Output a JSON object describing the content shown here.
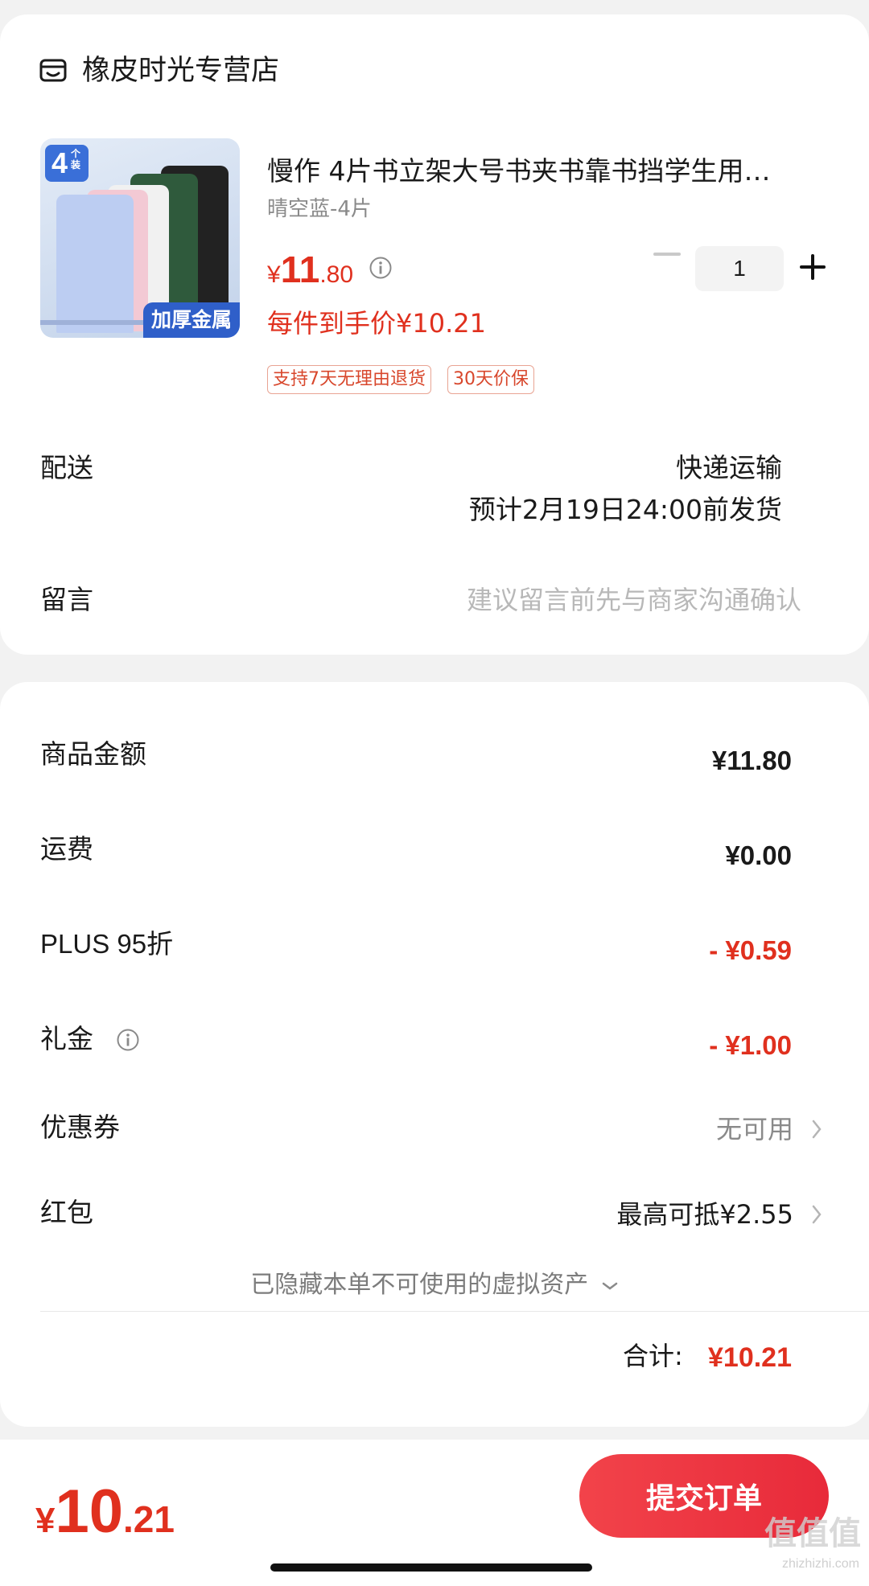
{
  "store": {
    "name": "橡皮时光专营店",
    "icon": "store-icon"
  },
  "product": {
    "title": "慢作 4片书立架大号书夹书靠书挡学生用…",
    "variant": "晴空蓝-4片",
    "price_currency": "¥",
    "price_int": "11",
    "price_dec": ".80",
    "final_price_text": "每件到手价¥10.21",
    "badges": [
      "支持7天无理由退货",
      "30天价保"
    ],
    "quantity": "1",
    "thumbnail": {
      "count": "4",
      "count_unit": "个装",
      "tag": "加厚金属"
    }
  },
  "delivery": {
    "label": "配送",
    "method": "快递运输",
    "eta": "预计2月19日24:00前发货"
  },
  "message": {
    "label": "留言",
    "placeholder": "建议留言前先与商家沟通确认"
  },
  "summary": {
    "rows": [
      {
        "label": "商品金额",
        "value": "¥11.80"
      },
      {
        "label": "运费",
        "value": "¥0.00"
      },
      {
        "label": "PLUS 95折",
        "value": "- ¥0.59"
      },
      {
        "label": "礼金",
        "value": "- ¥1.00"
      },
      {
        "label": "优惠券",
        "value": "无可用"
      },
      {
        "label": "红包",
        "value": "最高可抵¥2.55"
      }
    ],
    "hidden_assets": "已隐藏本单不可使用的虚拟资产",
    "total_label": "合计:",
    "total_value": "¥10.21"
  },
  "bottom": {
    "price_currency": "¥",
    "price_int": "10",
    "price_dec": ".21",
    "submit_label": "提交订单"
  },
  "watermark": {
    "main": "值值值",
    "sub": "zhizhizhi.com"
  },
  "colors": {
    "accent_red": "#e0301e",
    "button_red": "#ed3342",
    "badge_border": "#e9a493"
  }
}
